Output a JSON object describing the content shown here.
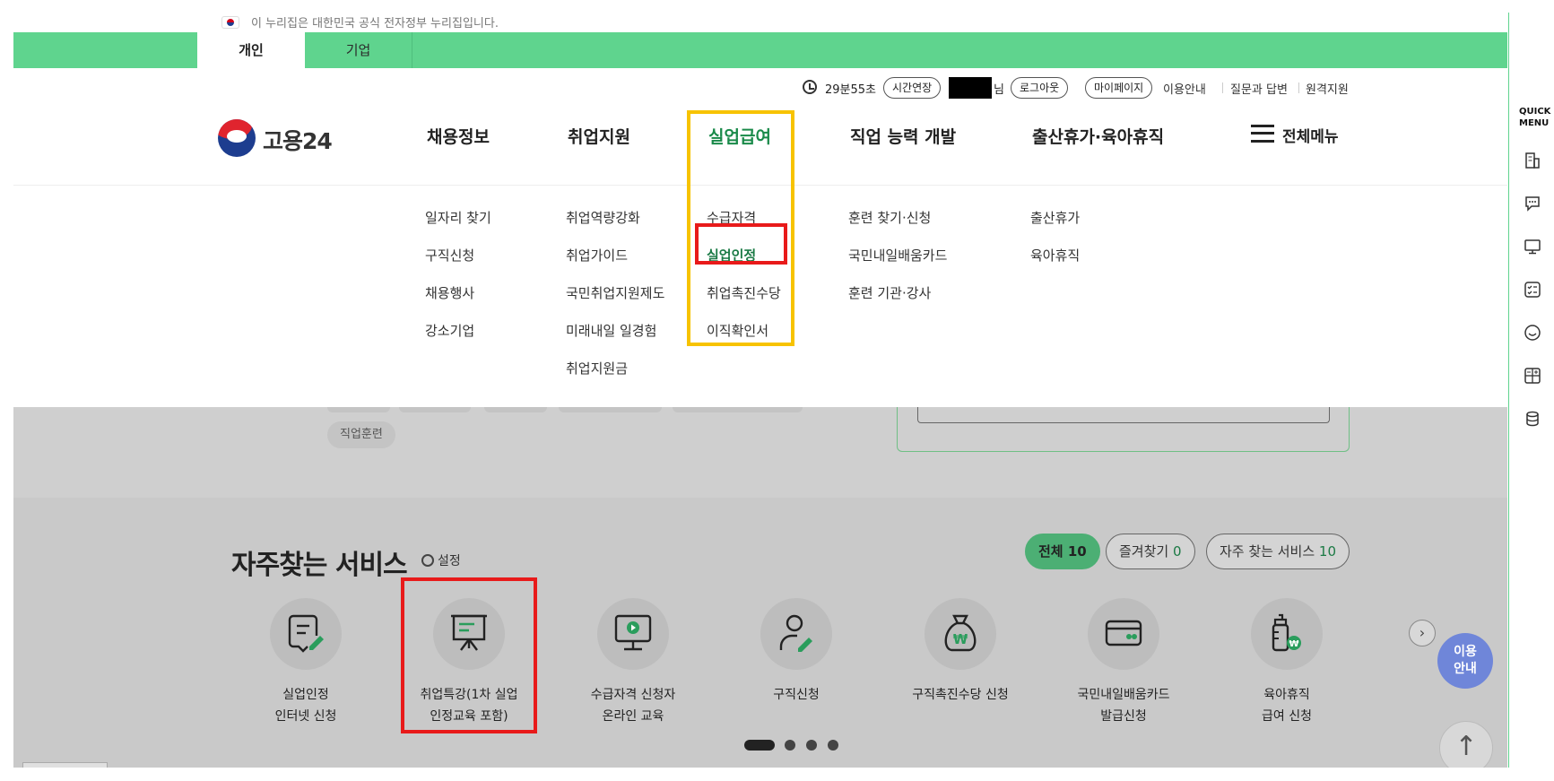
{
  "notice": {
    "text": "이 누리집은 대한민국 공식 전자정부 누리집입니다."
  },
  "tabs": [
    {
      "label": "개인"
    },
    {
      "label": "기업"
    }
  ],
  "util": {
    "timer": "29분55초",
    "extend": "시간연장",
    "nim": "님",
    "logout": "로그아웃",
    "mypage": "마이페이지",
    "links": [
      "이용안내",
      "질문과 답변",
      "원격지원"
    ]
  },
  "logo": {
    "name": "고용24"
  },
  "menu": [
    {
      "label": "채용정보",
      "subs": [
        "일자리 찾기",
        "구직신청",
        "채용행사",
        "강소기업"
      ]
    },
    {
      "label": "취업지원",
      "subs": [
        "취업역량강화",
        "취업가이드",
        "국민취업지원제도",
        "미래내일 일경험",
        "취업지원금"
      ]
    },
    {
      "label": "실업급여",
      "subs": [
        "수급자격",
        "실업인정",
        "취업촉진수당",
        "이직확인서"
      ]
    },
    {
      "label": "직업 능력 개발",
      "subs": [
        "훈련 찾기·신청",
        "국민내일배움카드",
        "훈련 기관·강사"
      ]
    },
    {
      "label": "출산휴가·육아휴직",
      "subs": [
        "출산휴가",
        "육아휴직"
      ]
    }
  ],
  "allmenu": "전체메뉴",
  "chips": [
    "직업훈련"
  ],
  "favorites": {
    "title": "자주찾는 서비스",
    "setting": "설정",
    "tabs": [
      {
        "label": "전체",
        "count": "10"
      },
      {
        "label": "즐겨찾기",
        "count": "0"
      },
      {
        "label": "자주 찾는 서비스",
        "count": "10"
      }
    ],
    "services": [
      {
        "line1": "실업인정",
        "line2": "인터넷 신청",
        "icon": "document-pen-icon"
      },
      {
        "line1": "취업특강(1차 실업",
        "line2": "인정교육 포함)",
        "icon": "presentation-board-icon"
      },
      {
        "line1": "수급자격 신청자",
        "line2": "온라인 교육",
        "icon": "monitor-play-icon"
      },
      {
        "line1": "구직신청",
        "line2": "",
        "icon": "person-pen-icon"
      },
      {
        "line1": "구직촉진수당 신청",
        "line2": "",
        "icon": "money-bag-icon"
      },
      {
        "line1": "국민내일배움카드",
        "line2": "발급신청",
        "icon": "card-icon"
      },
      {
        "line1": "육아휴직",
        "line2": "급여 신청",
        "icon": "baby-bottle-icon"
      }
    ]
  },
  "help": {
    "line1": "이용",
    "line2": "안내"
  },
  "quick": {
    "label1": "QUICK",
    "label2": "MENU"
  },
  "colors": {
    "brand_green": "#5fd48e",
    "highlight_yellow": "#f7c300",
    "highlight_red": "#e81a1a",
    "help_blue": "#6f86d9"
  }
}
